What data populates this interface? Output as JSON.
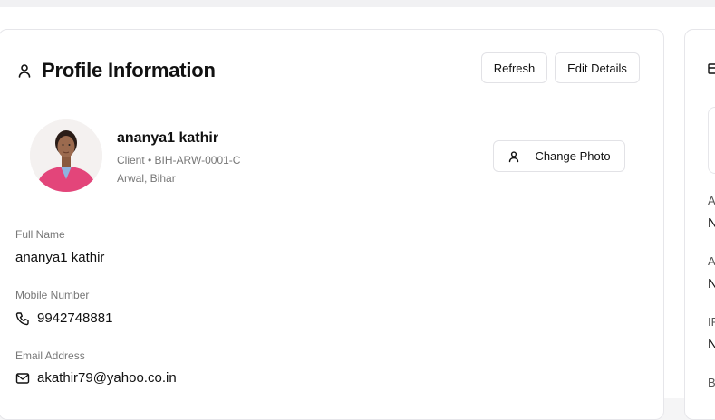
{
  "profile": {
    "title": "Profile Information",
    "refresh_label": "Refresh",
    "edit_label": "Edit Details",
    "name": "ananya1 kathir",
    "role_line": "Client • BIH-ARW-0001-C",
    "location": "Arwal, Bihar",
    "change_photo_label": "Change Photo"
  },
  "fields": {
    "full_name_label": "Full Name",
    "full_name_value": "ananya1 kathir",
    "mobile_label": "Mobile Number",
    "mobile_value": "9942748881",
    "email_label": "Email Address",
    "email_value": "akathir79@yahoo.co.in"
  },
  "right_panel": {
    "labels": [
      "A",
      "A",
      "IF",
      "B"
    ],
    "values": [
      "N",
      "N",
      "N"
    ]
  },
  "icons": {
    "title": "user-icon",
    "change_photo": "user-icon",
    "mobile": "phone-icon",
    "email": "mail-icon"
  },
  "colors": {
    "avatar_shirt": "#e3457a",
    "border": "#e6e6ea",
    "muted_text": "#777777"
  }
}
